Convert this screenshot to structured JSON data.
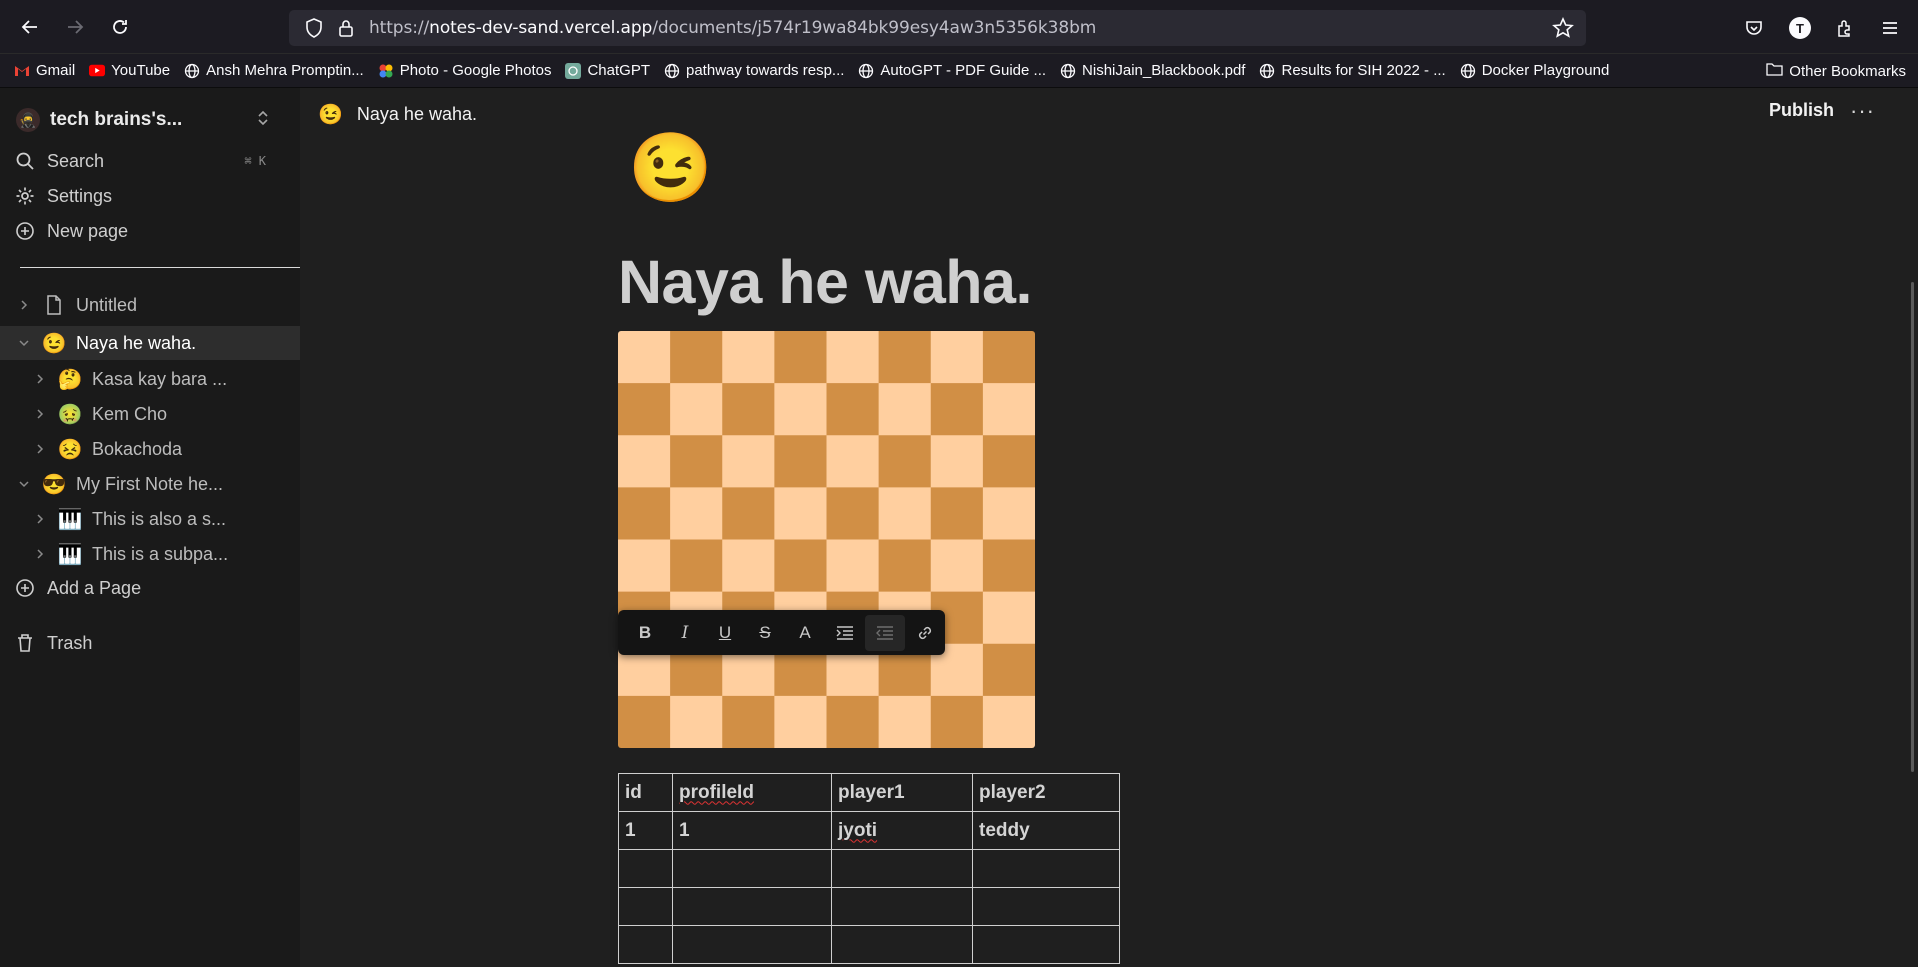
{
  "browser": {
    "url_prefix": "https://",
    "url_host": "notes-dev-sand.vercel.app",
    "url_path": "/documents/j574r19wa84bk99esy4aw3n5356k38bm",
    "profile_initial": "T"
  },
  "bookmarks": {
    "items": [
      {
        "label": "Gmail",
        "icon": "gmail-icon"
      },
      {
        "label": "YouTube",
        "icon": "youtube-icon"
      },
      {
        "label": "Ansh Mehra Promptin...",
        "icon": "globe-icon"
      },
      {
        "label": "Photo - Google Photos",
        "icon": "photos-icon"
      },
      {
        "label": "ChatGPT",
        "icon": "chatgpt-icon"
      },
      {
        "label": "pathway towards resp...",
        "icon": "globe-icon"
      },
      {
        "label": "AutoGPT - PDF Guide ...",
        "icon": "globe-icon"
      },
      {
        "label": "NishiJain_Blackbook.pdf",
        "icon": "globe-icon"
      },
      {
        "label": "Results for SIH 2022 - ...",
        "icon": "globe-icon"
      },
      {
        "label": "Docker Playground",
        "icon": "globe-icon"
      }
    ],
    "other": "Other Bookmarks"
  },
  "sidebar": {
    "workspace": "tech brains's...",
    "actions": [
      {
        "label": "Search",
        "icon": "search-icon",
        "shortcut": "⌘ K"
      },
      {
        "label": "Settings",
        "icon": "gear-icon",
        "shortcut": ""
      },
      {
        "label": "New page",
        "icon": "plus-circle-icon",
        "shortcut": ""
      }
    ],
    "tree": [
      {
        "label": "Untitled",
        "icon": "📄",
        "level": 0,
        "expanded": false,
        "active": false
      },
      {
        "label": "Naya he waha.",
        "icon": "😉",
        "level": 0,
        "expanded": true,
        "active": true
      },
      {
        "label": "Kasa kay bara ...",
        "icon": "🤔",
        "level": 1,
        "expanded": false,
        "active": false
      },
      {
        "label": "Kem Cho",
        "icon": "🤢",
        "level": 1,
        "expanded": false,
        "active": false
      },
      {
        "label": "Bokachoda",
        "icon": "😣",
        "level": 1,
        "expanded": false,
        "active": false
      },
      {
        "label": "My First Note he...",
        "icon": "😎",
        "level": 0,
        "expanded": true,
        "active": false
      },
      {
        "label": "This is also a s...",
        "icon": "🎹",
        "level": 1,
        "expanded": false,
        "active": false
      },
      {
        "label": "This is a subpa...",
        "icon": "🎹",
        "level": 1,
        "expanded": false,
        "active": false
      }
    ],
    "add_page": "Add a Page",
    "trash": "Trash"
  },
  "header": {
    "emoji": "😉",
    "title": "Naya he waha.",
    "publish": "Publish",
    "more": "···"
  },
  "document": {
    "emoji": "😉",
    "title": "Naya he waha.",
    "board": {
      "rows": 8,
      "cols": 8,
      "light": "#ffcf9f",
      "dark": "#d18f45"
    },
    "toolbar": [
      "B",
      "I",
      "U",
      "S",
      "A"
    ],
    "table": {
      "header": [
        "id",
        "profileId",
        "player1",
        "player2"
      ],
      "rows": [
        [
          "1",
          "1",
          "jyoti",
          "teddy"
        ],
        [
          "",
          "",
          "",
          ""
        ],
        [
          "",
          "",
          "",
          ""
        ],
        [
          "",
          "",
          "",
          ""
        ]
      ]
    }
  }
}
